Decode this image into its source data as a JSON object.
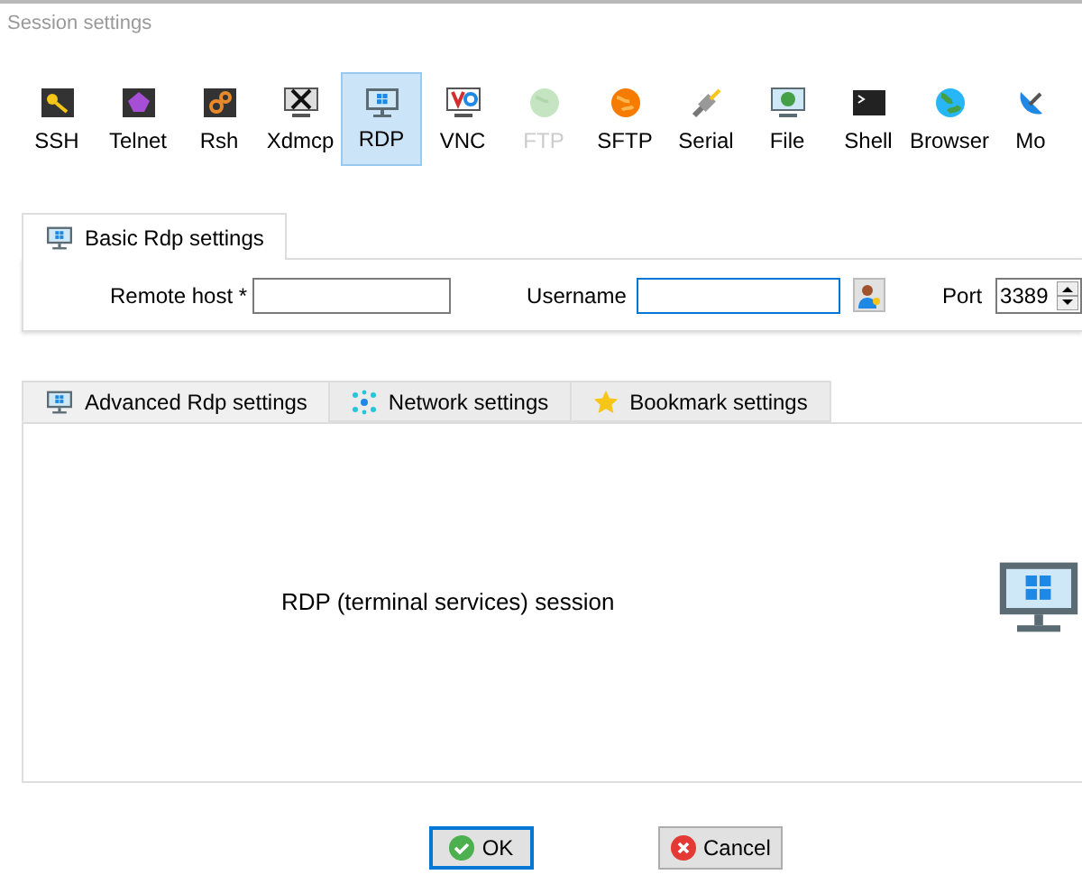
{
  "window": {
    "title": "Session settings"
  },
  "session_types": [
    {
      "label": "SSH",
      "selected": false,
      "disabled": false
    },
    {
      "label": "Telnet",
      "selected": false,
      "disabled": false
    },
    {
      "label": "Rsh",
      "selected": false,
      "disabled": false
    },
    {
      "label": "Xdmcp",
      "selected": false,
      "disabled": false
    },
    {
      "label": "RDP",
      "selected": true,
      "disabled": false
    },
    {
      "label": "VNC",
      "selected": false,
      "disabled": false
    },
    {
      "label": "FTP",
      "selected": false,
      "disabled": true
    },
    {
      "label": "SFTP",
      "selected": false,
      "disabled": false
    },
    {
      "label": "Serial",
      "selected": false,
      "disabled": false
    },
    {
      "label": "File",
      "selected": false,
      "disabled": false
    },
    {
      "label": "Shell",
      "selected": false,
      "disabled": false
    },
    {
      "label": "Browser",
      "selected": false,
      "disabled": false
    },
    {
      "label": "Mo",
      "selected": false,
      "disabled": false
    }
  ],
  "basic_tab": {
    "label": "Basic Rdp settings",
    "selected": true
  },
  "remote_host": {
    "label": "Remote host *"
  },
  "username": {
    "label": "Username"
  },
  "port": {
    "label": "Port",
    "value": "3389"
  },
  "advanced_tabs": [
    {
      "label": "Advanced Rdp settings",
      "selected": true
    },
    {
      "label": "Network settings",
      "selected": false
    },
    {
      "label": "Bookmark settings",
      "selected": false
    }
  ],
  "description": "RDP (terminal services) session",
  "buttons": [
    {
      "label": "OK",
      "kind": "ok",
      "focused": true
    },
    {
      "label": "Cancel",
      "kind": "cancel",
      "focused": false
    }
  ]
}
